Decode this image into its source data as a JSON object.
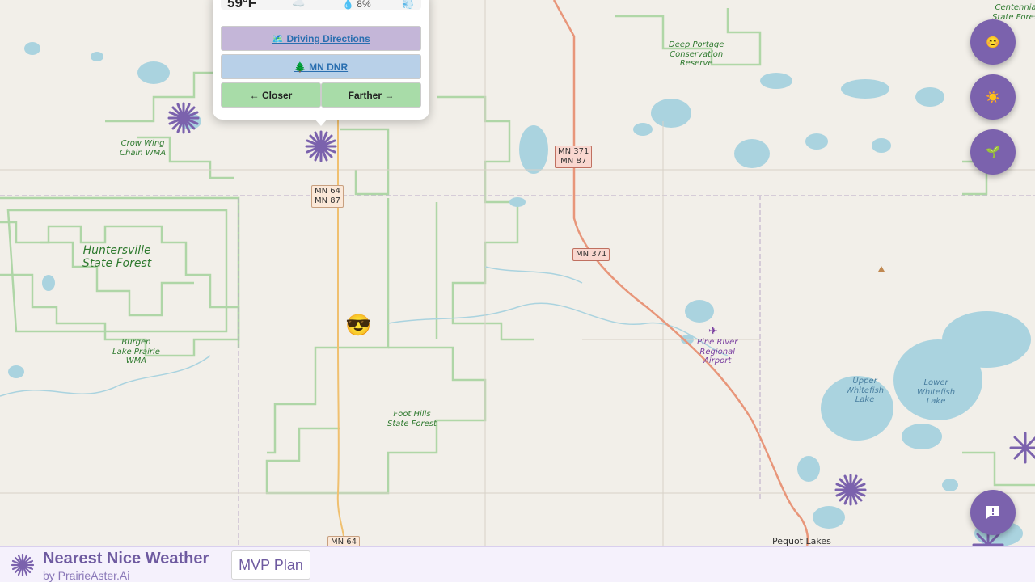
{
  "app": {
    "title": "Nearest Nice Weather",
    "subtitle": "by PrairieAster.Ai",
    "mvp_label": "MVP Plan"
  },
  "popup": {
    "temperature": "59°F",
    "precip": "💧 8%",
    "cloud_icon": "☁️",
    "wind_icon": "💨",
    "directions_label": "🗺️ Driving Directions",
    "dnr_label": "🌲 MN DNR",
    "closer_label": "← Closer",
    "farther_label": "Farther →"
  },
  "fabs": [
    {
      "icon": "😊",
      "name": "mood-filter"
    },
    {
      "icon": "☀️",
      "name": "weather-filter"
    },
    {
      "icon": "🌱",
      "name": "nature-filter"
    },
    {
      "icon": "!",
      "name": "feedback"
    }
  ],
  "map": {
    "labels": {
      "crow_wing": "Crow Wing\nChain WMA",
      "huntersville": "Huntersville\nState Forest",
      "burgen": "Burgen\nLake Prairie\nWMA",
      "foot_hills": "Foot Hills\nState Forest",
      "deep_portage": "Deep Portage\nConservation\nReserve",
      "centennial": "Centennial\nState Forest",
      "pine_river": "Pine River\nRegional\nAirport",
      "upper_whitefish": "Upper\nWhitefish\nLake",
      "lower_whitefish": "Lower\nWhitefish\nLake",
      "pequot": "Pequot Lakes"
    },
    "shields": {
      "mn64_87": "MN 64\nMN 87",
      "mn371_87": "MN 371\nMN 87",
      "mn371": "MN 371",
      "mn64": "MN 64"
    },
    "user_marker": "😎",
    "airport_icon": "✈"
  },
  "colors": {
    "accent": "#7b62ad",
    "forest": "#a8d4a0",
    "water": "#aad3df",
    "road": "#e8967a"
  }
}
